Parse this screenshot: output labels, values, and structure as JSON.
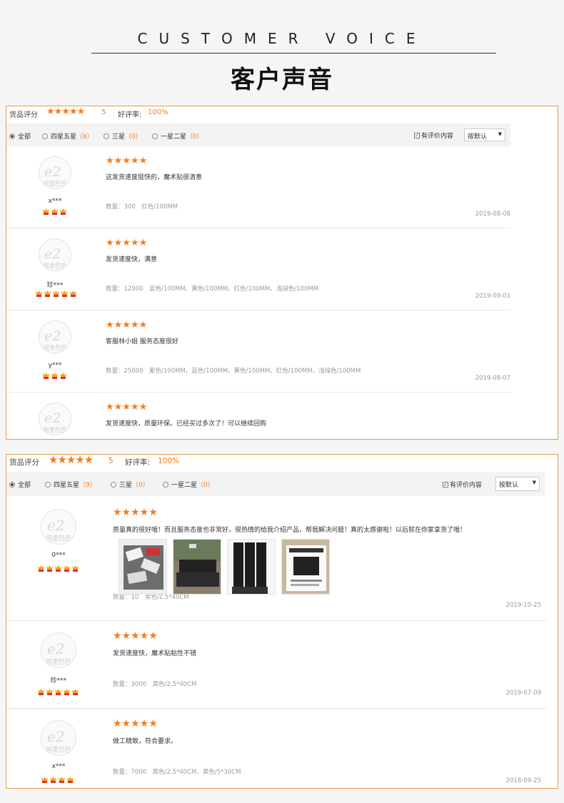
{
  "header": {
    "english_title": "CUSTOMER VOICE",
    "chinese_title": "客户声音"
  },
  "colors": {
    "accent": "#f47c20",
    "border": "#e69a4c"
  },
  "panels": [
    {
      "rating_label": "货品评分",
      "stars": "★★★★★",
      "score": "5",
      "good_label": "好评率:",
      "good_rate": "100%",
      "filters": [
        {
          "label": "全部",
          "count": "",
          "selected": true
        },
        {
          "label": "四星五星",
          "count": "（6）",
          "selected": false
        },
        {
          "label": "三星",
          "count": "（0）",
          "selected": false
        },
        {
          "label": "一星二星",
          "count": "（0）",
          "selected": false
        }
      ],
      "has_content_label": "有评价内容",
      "sort_label": "按默认",
      "avatar_logo": "阿里巴巴",
      "reviews": [
        {
          "user": "x***",
          "badges": 3,
          "stars": "★★★★★",
          "text": "这发货速度挺快的，魔术贴很清意",
          "spec": "数量：300　红色/100MM",
          "date": "2019-08-08"
        },
        {
          "user": "珍***",
          "badges": 5,
          "stars": "★★★★★",
          "text": "发货速度快，满意",
          "spec": "数量：12000　蓝色/100MM、黄色/100MM、红色/100MM、浅绿色/100MM",
          "date": "2019-09-01"
        },
        {
          "user": "y***",
          "badges": 3,
          "stars": "★★★★★",
          "text": "客服林小姐 服务态度很好",
          "spec": "数量：25000　紫色/100MM、蓝色/100MM、黄色/100MM、红色/100MM、浅绿色/100MM",
          "date": "2019-08-07"
        },
        {
          "user": "",
          "badges": 0,
          "stars": "★★★★★",
          "text": "发货速度快，质量环保。已经买过多次了！可以继续回购",
          "spec": "",
          "date": ""
        }
      ]
    },
    {
      "rating_label": "货品评分",
      "stars": "★★★★★",
      "score": "5",
      "good_label": "好评率:",
      "good_rate": "100%",
      "filters": [
        {
          "label": "全部",
          "count": "",
          "selected": true
        },
        {
          "label": "四星五星",
          "count": "（9）",
          "selected": false
        },
        {
          "label": "三星",
          "count": "（0）",
          "selected": false
        },
        {
          "label": "一星二星",
          "count": "（0）",
          "selected": false
        }
      ],
      "has_content_label": "有评价内容",
      "sort_label": "按默认",
      "avatar_logo": "阿里巴巴",
      "reviews": [
        {
          "user": "0***",
          "badges": 5,
          "stars": "★★★★★",
          "text": "质量真的很好哦！而且服务态度也非常好，很热情的给我介绍产品，帮我解决问题！真的太感谢啦！以后就在你家拿货了哦！",
          "spec": "数量：10　黑色/2.5*40CM",
          "date": "2019-10-25",
          "images": [
            "photo-1",
            "photo-2",
            "photo-3",
            "photo-4"
          ]
        },
        {
          "user": "珍***",
          "badges": 5,
          "stars": "★★★★★",
          "text": "发货速度快，魔术贴粘性不错",
          "spec": "数量：3000　黑色/2.5*40CM",
          "date": "2019-07-09"
        },
        {
          "user": "x***",
          "badges": 4,
          "stars": "★★★★★",
          "text": "做工精致，符合要求。",
          "spec": "数量：7000　黑色/2.5*40CM、黑色/5*30CM",
          "date": "2018-09-25"
        }
      ]
    }
  ]
}
